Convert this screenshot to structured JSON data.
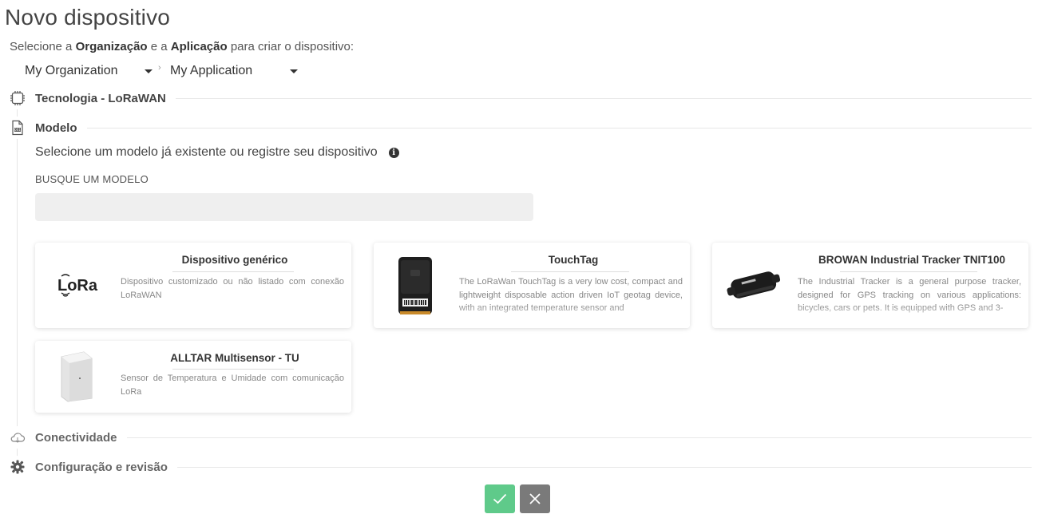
{
  "header": {
    "title": "Novo dispositivo",
    "subtitle_parts": [
      "Selecione a ",
      "Organização",
      " e a ",
      "Aplicação",
      " para criar o dispositivo:"
    ]
  },
  "selectors": {
    "organization": "My Organization",
    "application": "My Application",
    "separator": "›"
  },
  "steps": {
    "technology": "Tecnologia - LoRaWAN",
    "model": "Modelo",
    "connectivity": "Conectividade",
    "configuration": "Configuração e revisão"
  },
  "model_section": {
    "prompt": "Selecione um modelo já existente ou registre seu dispositivo",
    "info_glyph": "i",
    "search_label": "BUSQUE UM MODELO",
    "search_value": "",
    "search_placeholder": ""
  },
  "cards": [
    {
      "title": "Dispositivo genérico",
      "logo_text": "LoRa",
      "description": "Dispositivo customizado ou não listado com conexão LoRaWAN"
    },
    {
      "title": "TouchTag",
      "description": "The LoRaWan TouchTag is a very low cost, compact and lightweight disposable action driven IoT geotag device, with an integrated temperature sensor and"
    },
    {
      "title": "BROWAN Industrial Tracker TNIT100",
      "description": "The Industrial Tracker is a general purpose tracker, designed for GPS tracking on various applications: bicycles, cars or pets. It is equipped with GPS and 3-"
    },
    {
      "title": "ALLTAR Multisensor - TU",
      "description": "Sensor de Temperatura e Umidade com comunicação LoRa"
    }
  ],
  "actions": {
    "confirm_icon": "check-icon",
    "cancel_icon": "close-icon"
  },
  "colors": {
    "confirm": "#5fca8a",
    "cancel": "#7a7a7a",
    "title_text": "#444444"
  }
}
